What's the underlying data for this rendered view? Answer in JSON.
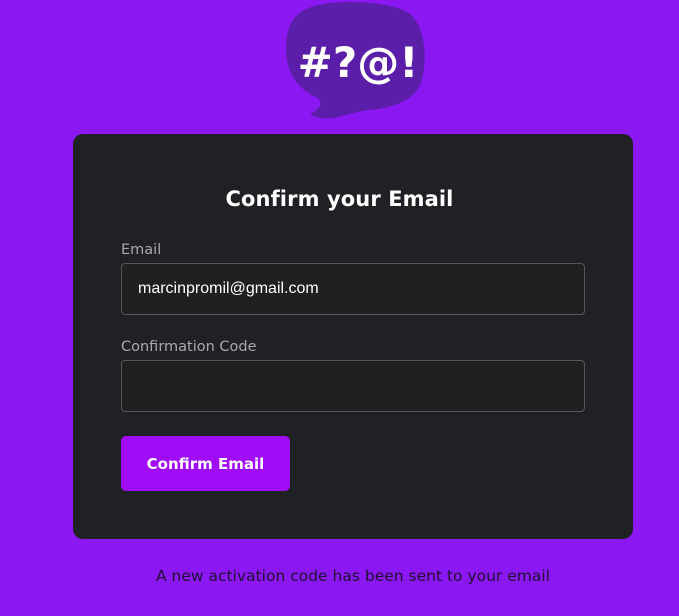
{
  "logo": {
    "text": "#?@!",
    "bubble_color": "#5b1ea8",
    "text_color": "#ffffff"
  },
  "form": {
    "title": "Confirm your Email",
    "email_label": "Email",
    "email_value": "marcinpromil@gmail.com",
    "code_label": "Confirmation Code",
    "code_value": "",
    "submit_label": "Confirm Email"
  },
  "footer": {
    "message": "A new activation code has been sent to your email"
  },
  "colors": {
    "background": "#8b17f2",
    "card": "#202124",
    "accent": "#a10cf7"
  }
}
